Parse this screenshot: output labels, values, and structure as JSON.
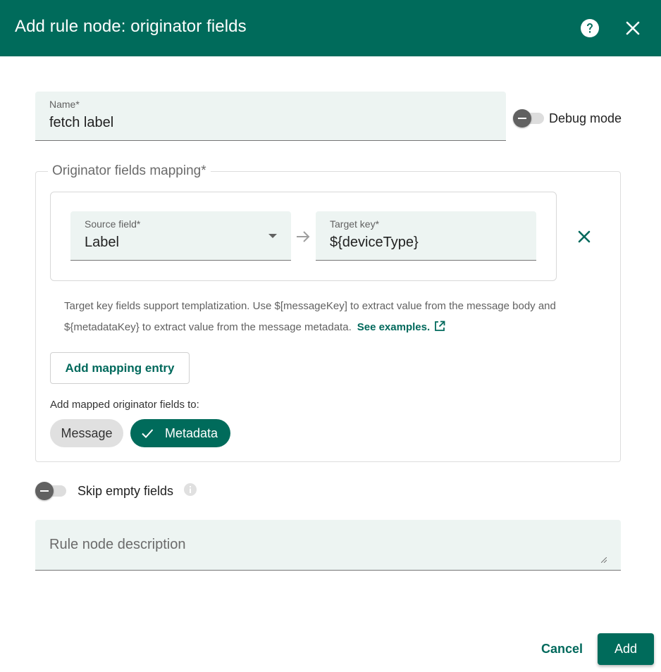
{
  "dialog": {
    "title": "Add rule node: originator fields",
    "help_icon": "help-circle-icon",
    "close_icon": "close-icon"
  },
  "name_field": {
    "label": "Name*",
    "value": "fetch label"
  },
  "debug_mode": {
    "label": "Debug mode",
    "enabled": false
  },
  "mapping": {
    "legend": "Originator fields mapping*",
    "entries": [
      {
        "source_label": "Source field*",
        "source_value": "Label",
        "target_label": "Target key*",
        "target_value": "${deviceType}"
      }
    ],
    "hint_text": "Target key fields support templatization. Use $[messageKey] to extract value from the message body and ${metadataKey} to extract value from the message metadata.",
    "see_examples": "See examples.",
    "add_entry_label": "Add mapping entry",
    "add_to_label": "Add mapped originator fields to:",
    "chips": [
      {
        "label": "Message",
        "selected": false
      },
      {
        "label": "Metadata",
        "selected": true
      }
    ]
  },
  "skip_empty": {
    "label": "Skip empty fields",
    "enabled": false
  },
  "description": {
    "placeholder": "Rule node description",
    "value": ""
  },
  "footer": {
    "cancel_label": "Cancel",
    "add_label": "Add"
  },
  "colors": {
    "primary": "#006b5b",
    "link": "#00695c",
    "field_bg": "#edf4f2"
  }
}
